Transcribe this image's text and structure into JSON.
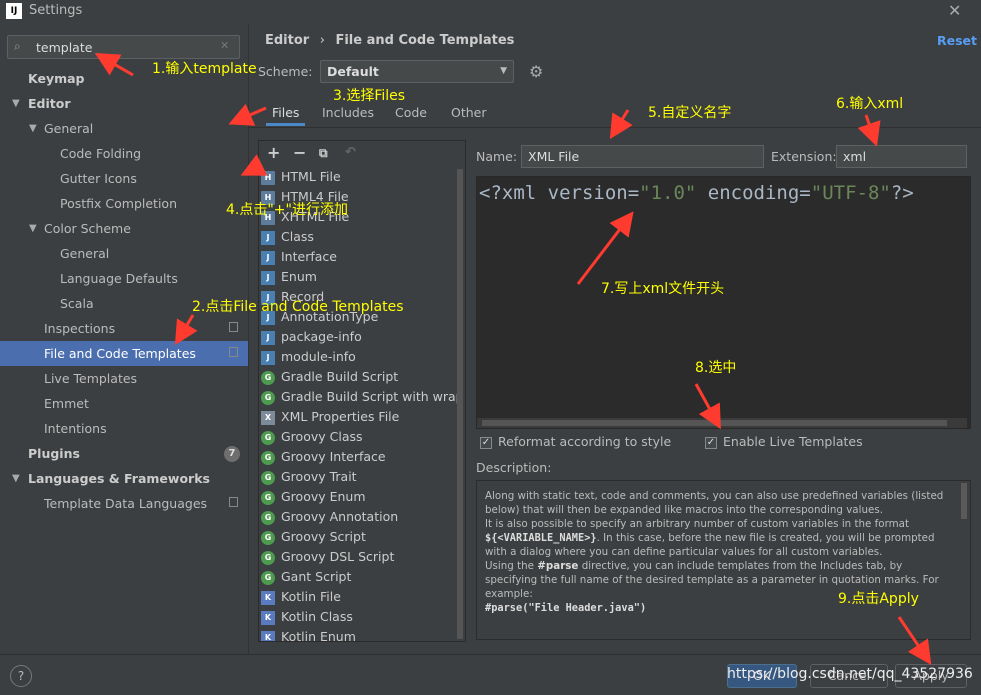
{
  "window": {
    "title": "Settings",
    "app_icon": "IJ"
  },
  "search": {
    "value": "template",
    "placeholder": ""
  },
  "sidebar": {
    "items": [
      {
        "label": "Keymap"
      },
      {
        "label": "Editor"
      },
      {
        "label": "General"
      },
      {
        "label": "Code Folding"
      },
      {
        "label": "Gutter Icons"
      },
      {
        "label": "Postfix Completion"
      },
      {
        "label": "Color Scheme"
      },
      {
        "label": "General"
      },
      {
        "label": "Language Defaults"
      },
      {
        "label": "Scala"
      },
      {
        "label": "Inspections"
      },
      {
        "label": "File and Code Templates"
      },
      {
        "label": "Live Templates"
      },
      {
        "label": "Emmet"
      },
      {
        "label": "Intentions"
      },
      {
        "label": "Plugins",
        "badge": "7"
      },
      {
        "label": "Languages & Frameworks"
      },
      {
        "label": "Template Data Languages"
      }
    ]
  },
  "breadcrumb": {
    "part1": "Editor",
    "sep": "›",
    "part2": "File and Code Templates"
  },
  "reset_label": "Reset",
  "scheme": {
    "label": "Scheme:",
    "value": "Default"
  },
  "tabs": [
    {
      "label": "Files"
    },
    {
      "label": "Includes"
    },
    {
      "label": "Code"
    },
    {
      "label": "Other"
    }
  ],
  "templates": [
    {
      "label": "HTML File",
      "icon": "H"
    },
    {
      "label": "HTML4 File",
      "icon": "H"
    },
    {
      "label": "XHTML File",
      "icon": "H"
    },
    {
      "label": "Class",
      "icon": "J"
    },
    {
      "label": "Interface",
      "icon": "J"
    },
    {
      "label": "Enum",
      "icon": "J"
    },
    {
      "label": "Record",
      "icon": "J"
    },
    {
      "label": "AnnotationType",
      "icon": "J"
    },
    {
      "label": "package-info",
      "icon": "J"
    },
    {
      "label": "module-info",
      "icon": "J"
    },
    {
      "label": "Gradle Build Script",
      "icon": "G"
    },
    {
      "label": "Gradle Build Script with wrappe",
      "icon": "G"
    },
    {
      "label": "XML Properties File",
      "icon": "X"
    },
    {
      "label": "Groovy Class",
      "icon": "G"
    },
    {
      "label": "Groovy Interface",
      "icon": "G"
    },
    {
      "label": "Groovy Trait",
      "icon": "G"
    },
    {
      "label": "Groovy Enum",
      "icon": "G"
    },
    {
      "label": "Groovy Annotation",
      "icon": "G"
    },
    {
      "label": "Groovy Script",
      "icon": "G"
    },
    {
      "label": "Groovy DSL Script",
      "icon": "G"
    },
    {
      "label": "Gant Script",
      "icon": "G"
    },
    {
      "label": "Kotlin File",
      "icon": "K"
    },
    {
      "label": "Kotlin Class",
      "icon": "K"
    },
    {
      "label": "Kotlin Enum",
      "icon": "K"
    }
  ],
  "form": {
    "name_label": "Name:",
    "name_value": "XML File",
    "ext_label": "Extension:",
    "ext_value": "xml"
  },
  "editor": {
    "p1": "<?xml version=",
    "s1": "\"1.0\"",
    "p2": " encoding=",
    "s2": "\"UTF-8\"",
    "p3": "?>"
  },
  "checkboxes": {
    "reformat": "Reformat according to style",
    "live": "Enable Live Templates"
  },
  "description": {
    "label": "Description:",
    "line1": "Along with static text, code and comments, you can also use predefined variables (listed below) that will then be expanded like macros into the corresponding values.",
    "line2a": "It is also possible to specify an arbitrary number of custom variables in the format ",
    "line2var": "${<VARIABLE_NAME>}",
    "line2b": ". In this case, before the new file is created, you will be prompted with a dialog where you can define particular values for all custom variables.",
    "line3a": "Using the ",
    "line3kw": "#parse",
    "line3b": " directive, you can include templates from the Includes tab, by specifying the full name of the desired template as a parameter in quotation marks. For example:",
    "line4": "#parse(\"File Header.java\")"
  },
  "buttons": {
    "help": "?",
    "ok": "OK",
    "cancel": "Cancel",
    "apply": "Apply"
  },
  "annotations": {
    "a1": "1.输入template",
    "a2": "2.点击File and Code Templates",
    "a3": "3.选择Files",
    "a4": "4.点击\"+\"进行添加",
    "a5": "5.自定义名字",
    "a6": "6.输入xml",
    "a7": "7.写上xml文件开头",
    "a8": "8.选中",
    "a9": "9.点击Apply"
  },
  "watermark": "https://blog.csdn.net/qq_43527936",
  "colors": {
    "accent": "#4b6eaf",
    "annotation": "#ffff00",
    "arrow": "#ff3b30"
  }
}
